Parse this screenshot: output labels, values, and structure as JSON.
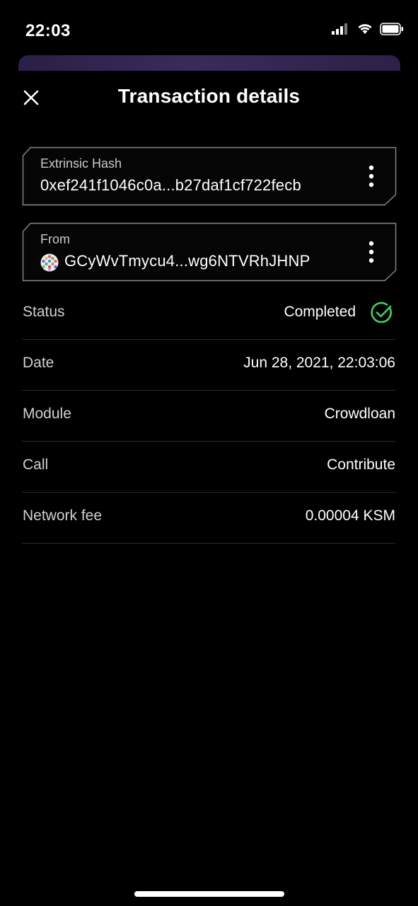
{
  "status_bar": {
    "time": "22:03"
  },
  "header": {
    "title": "Transaction details"
  },
  "fields": {
    "hash": {
      "label": "Extrinsic Hash",
      "value": "0xef241f1046c0a...b27daf1cf722fecb"
    },
    "from": {
      "label": "From",
      "value": "GCyWvTmycu4...wg6NTVRhJHNP"
    }
  },
  "details": {
    "status": {
      "label": "Status",
      "value": "Completed"
    },
    "date": {
      "label": "Date",
      "value": "Jun 28, 2021, 22:03:06"
    },
    "module": {
      "label": "Module",
      "value": "Crowdloan"
    },
    "call": {
      "label": "Call",
      "value": "Contribute"
    },
    "fee": {
      "label": "Network fee",
      "value": "0.00004 KSM"
    }
  },
  "colors": {
    "success": "#3fcf63",
    "background": "#000000",
    "accent": "#3b2a5c"
  },
  "icons": [
    "close-icon",
    "more-vertical-icon",
    "check-circle-icon",
    "identicon-avatar",
    "signal-icon",
    "wifi-icon",
    "battery-icon"
  ]
}
